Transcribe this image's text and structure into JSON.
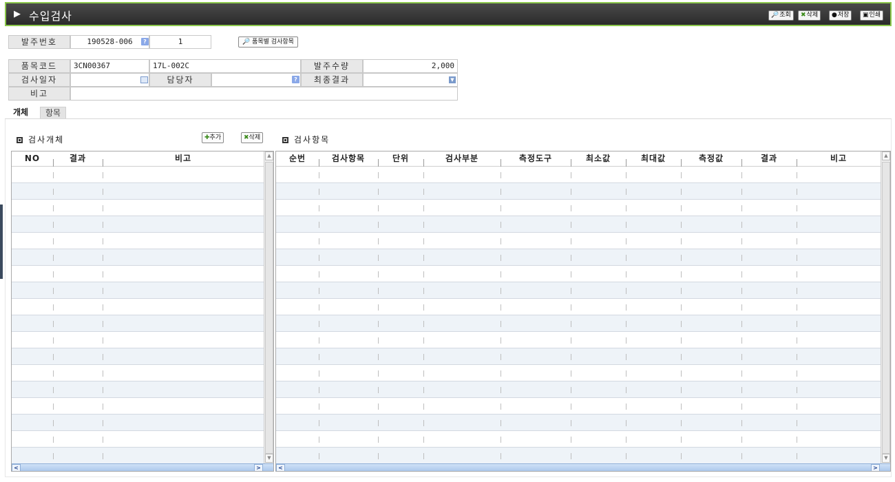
{
  "header": {
    "title": "수입검사",
    "buttons": {
      "search": "조회",
      "delete": "삭제",
      "save": "저장",
      "print": "인쇄"
    }
  },
  "form": {
    "order_no_label": "발주번호",
    "order_no_value": "190528-006",
    "order_seq_value": "1",
    "item_inspection_button": "품목별 검사항목",
    "item_code_label": "품목코드",
    "item_code_value": "3CN00367",
    "item_spec_value": "17L-002C",
    "order_qty_label": "발주수량",
    "order_qty_value": "2,000",
    "inspect_date_label": "검사일자",
    "inspect_date_value": "",
    "manager_label": "담당자",
    "manager_value": "",
    "final_result_label": "최종결과",
    "final_result_value": "",
    "remark_label": "비고",
    "remark_value": ""
  },
  "tabs": [
    {
      "label": "개체",
      "active": true
    },
    {
      "label": "항목",
      "active": false
    }
  ],
  "left_panel": {
    "title": "검사개체",
    "add_button": "추가",
    "delete_button": "삭제",
    "columns": [
      "NO",
      "결과",
      "비고"
    ],
    "rows": []
  },
  "right_panel": {
    "title": "검사항목",
    "columns": [
      "순번",
      "검사항목",
      "단위",
      "검사부분",
      "측정도구",
      "최소값",
      "최대값",
      "측정값",
      "결과",
      "비고"
    ],
    "rows": []
  },
  "colors": {
    "title_bg": "#2b2b2b",
    "title_border": "#8cc84b",
    "row_alt": "#eef3f8",
    "label_bg": "#e8e8e8"
  }
}
